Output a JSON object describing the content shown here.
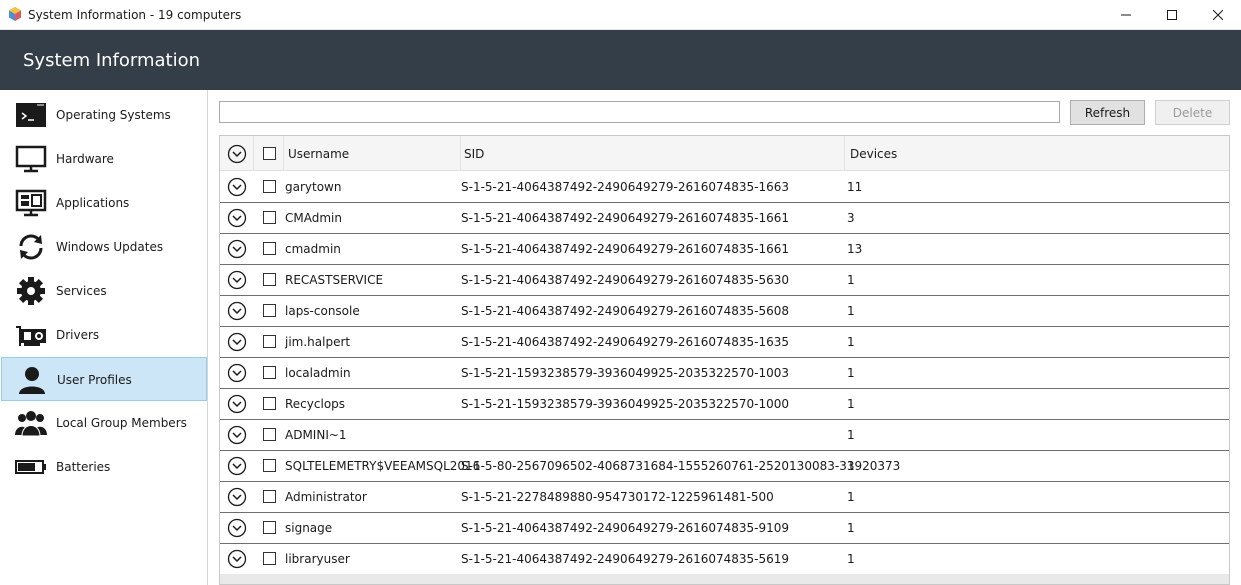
{
  "window": {
    "title": "System Information - 19 computers",
    "icon": "app-logo-icon",
    "controls": [
      "minimize-icon",
      "maximize-icon",
      "close-icon"
    ]
  },
  "header": {
    "title": "System Information"
  },
  "sidebar": {
    "active_index": 6,
    "items": [
      {
        "label": "Operating Systems",
        "icon": "terminal-icon"
      },
      {
        "label": "Hardware",
        "icon": "monitor-icon"
      },
      {
        "label": "Applications",
        "icon": "applications-icon"
      },
      {
        "label": "Windows Updates",
        "icon": "refresh-icon"
      },
      {
        "label": "Services",
        "icon": "gear-icon"
      },
      {
        "label": "Drivers",
        "icon": "driver-card-icon"
      },
      {
        "label": "User Profiles",
        "icon": "user-icon"
      },
      {
        "label": "Local Group Members",
        "icon": "group-icon"
      },
      {
        "label": "Batteries",
        "icon": "battery-icon"
      }
    ]
  },
  "toolbar": {
    "search_value": "",
    "refresh_label": "Refresh",
    "delete_label": "Delete"
  },
  "grid": {
    "columns": {
      "username": "Username",
      "sid": "SID",
      "devices": "Devices"
    },
    "rows": [
      {
        "username": "garytown",
        "sid": "S-1-5-21-4064387492-2490649279-2616074835-1663",
        "devices": "11"
      },
      {
        "username": "CMAdmin",
        "sid": "S-1-5-21-4064387492-2490649279-2616074835-1661",
        "devices": "3"
      },
      {
        "username": "cmadmin",
        "sid": "S-1-5-21-4064387492-2490649279-2616074835-1661",
        "devices": "13"
      },
      {
        "username": "RECASTSERVICE",
        "sid": "S-1-5-21-4064387492-2490649279-2616074835-5630",
        "devices": "1"
      },
      {
        "username": "laps-console",
        "sid": "S-1-5-21-4064387492-2490649279-2616074835-5608",
        "devices": "1"
      },
      {
        "username": "jim.halpert",
        "sid": "S-1-5-21-4064387492-2490649279-2616074835-1635",
        "devices": "1"
      },
      {
        "username": "localadmin",
        "sid": "S-1-5-21-1593238579-3936049925-2035322570-1003",
        "devices": "1"
      },
      {
        "username": "Recyclops",
        "sid": "S-1-5-21-1593238579-3936049925-2035322570-1000",
        "devices": "1"
      },
      {
        "username": "ADMINI~1",
        "sid": "",
        "devices": "1"
      },
      {
        "username": "SQLTELEMETRY$VEEAMSQL2016",
        "sid": "S-1-5-80-2567096502-4068731684-1555260761-2520130083-33920373",
        "devices": "1"
      },
      {
        "username": "Administrator",
        "sid": "S-1-5-21-2278489880-954730172-1225961481-500",
        "devices": "1"
      },
      {
        "username": "signage",
        "sid": "S-1-5-21-4064387492-2490649279-2616074835-9109",
        "devices": "1"
      },
      {
        "username": "libraryuser",
        "sid": "S-1-5-21-4064387492-2490649279-2616074835-5619",
        "devices": "1"
      }
    ]
  }
}
